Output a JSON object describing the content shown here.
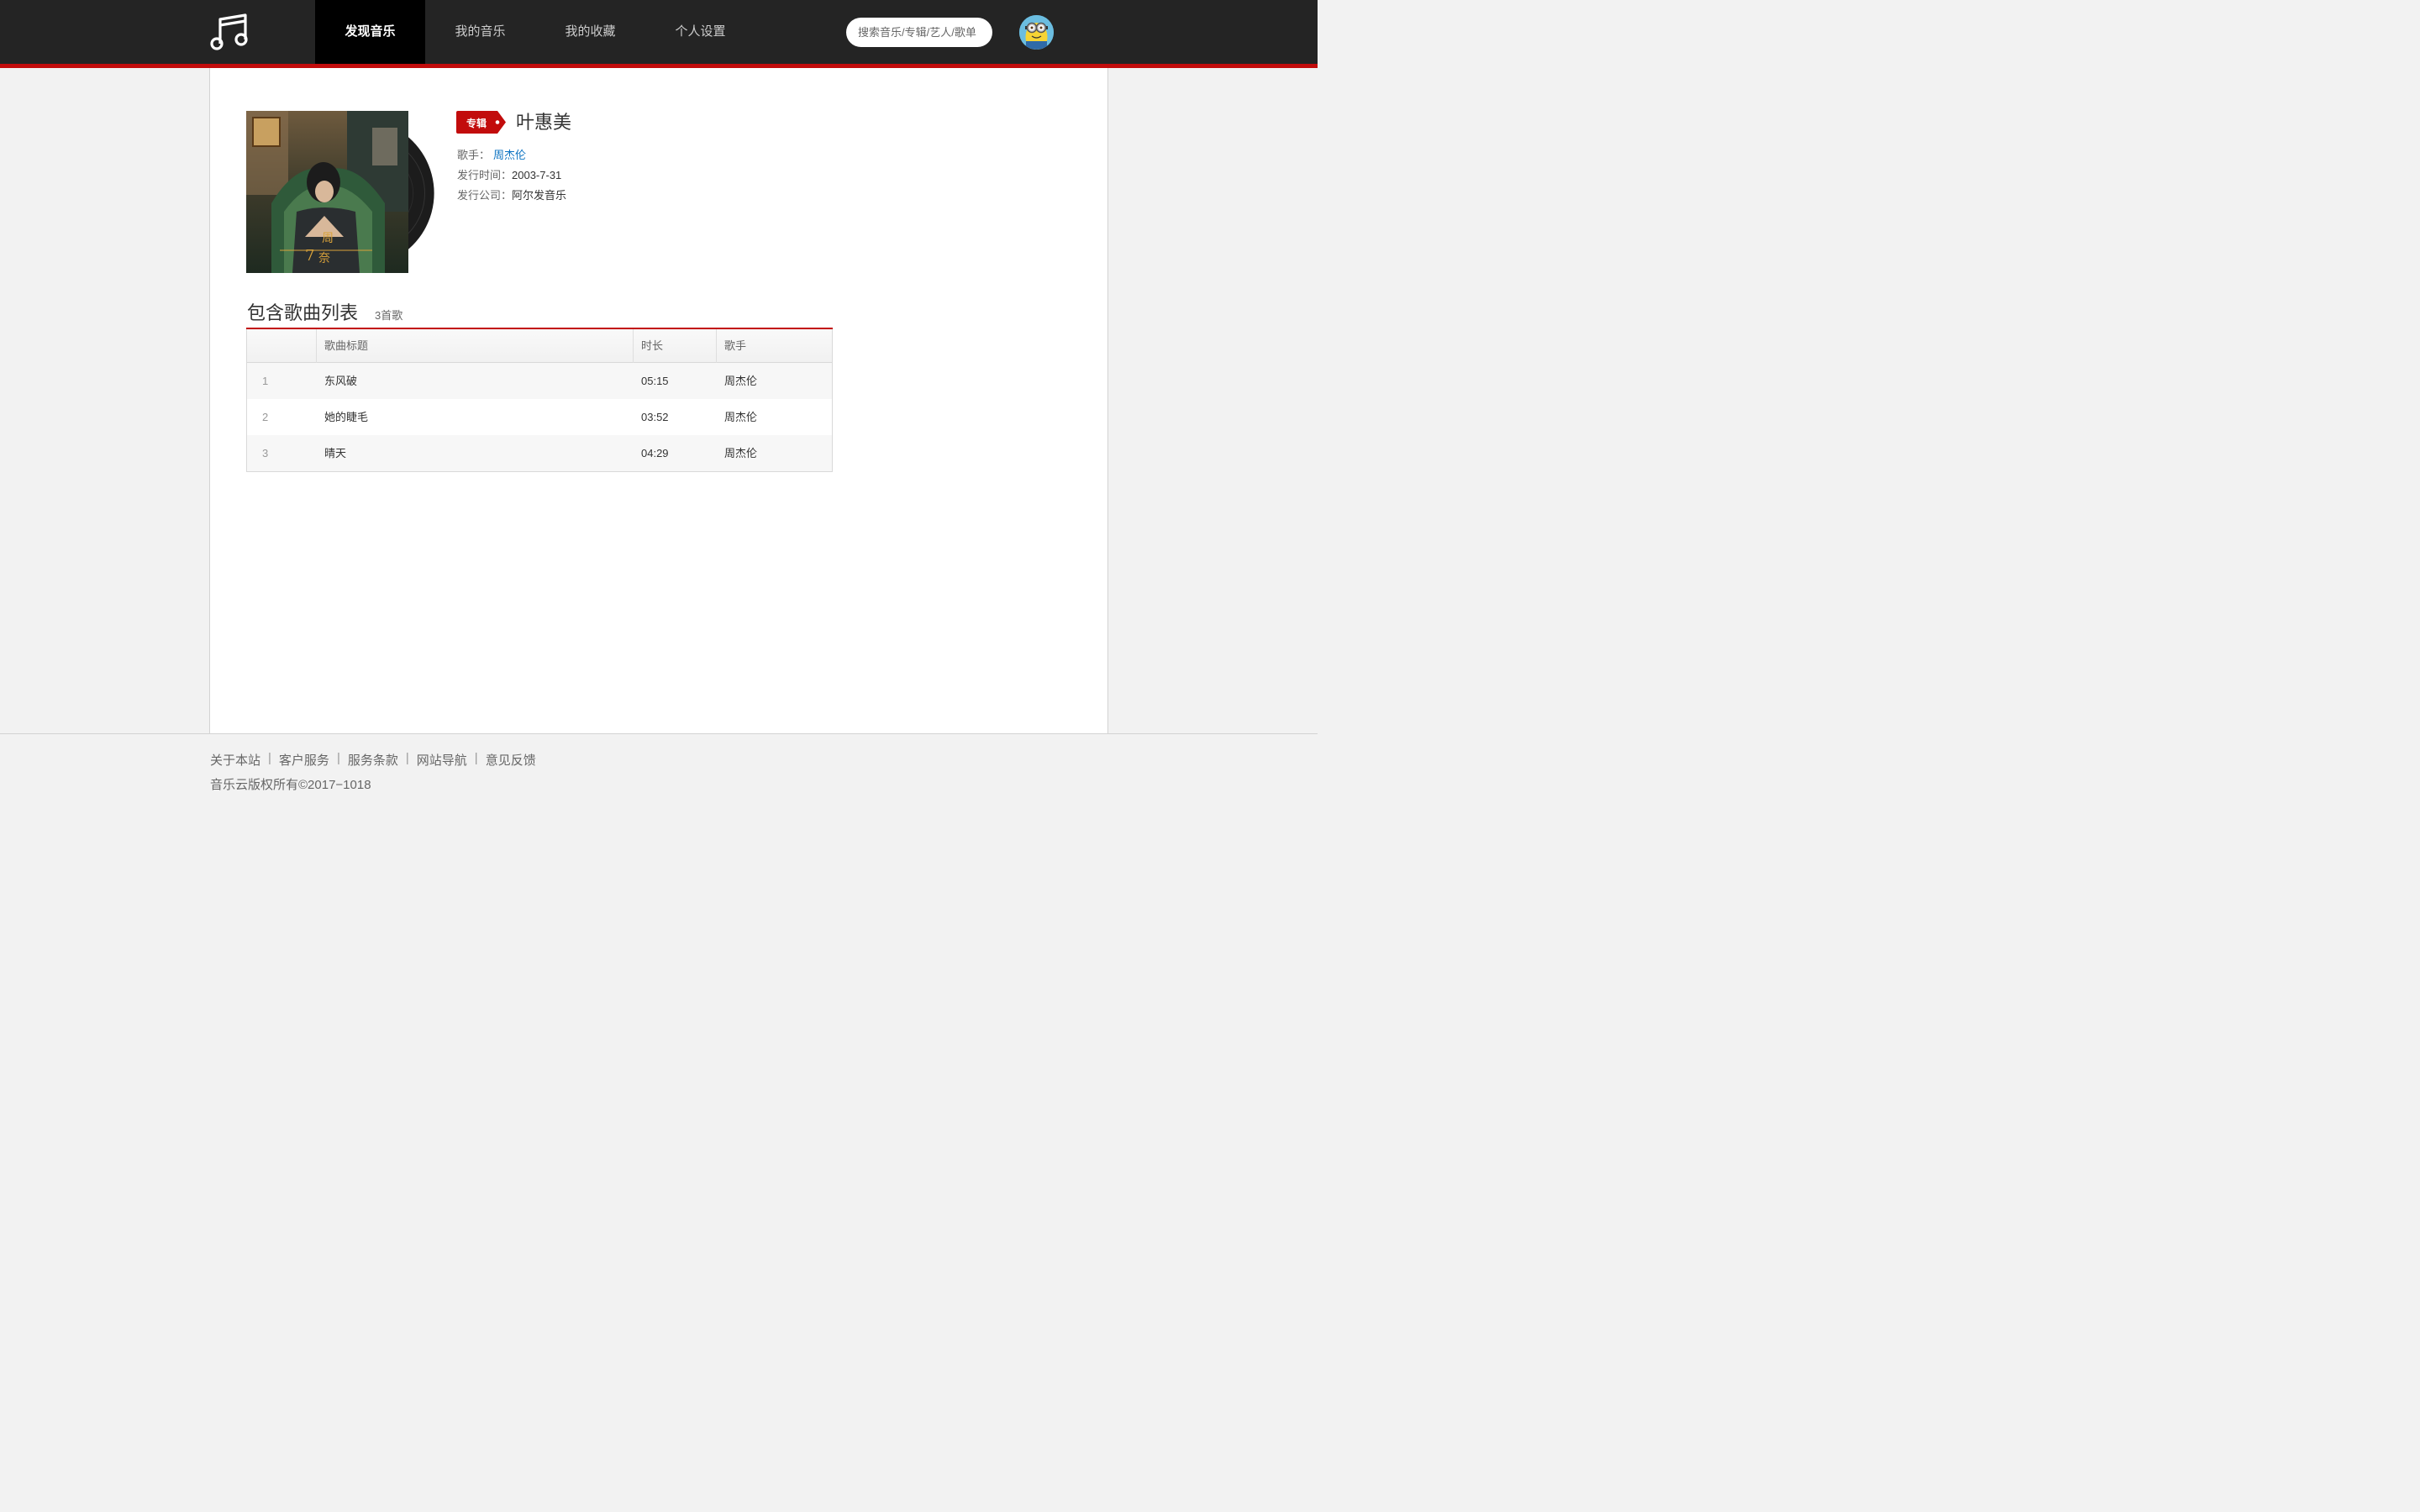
{
  "nav": {
    "items": [
      {
        "label": "发现音乐",
        "active": true
      },
      {
        "label": "我的音乐",
        "active": false
      },
      {
        "label": "我的收藏",
        "active": false
      },
      {
        "label": "个人设置",
        "active": false
      }
    ],
    "search_placeholder": "搜索音乐/专辑/艺人/歌单",
    "logo_icon": "music-note-icon",
    "avatar_icon": "minion-avatar"
  },
  "album": {
    "tag_label": "专辑",
    "title": "叶惠美",
    "artist_label": "歌手：",
    "artist": "周杰伦",
    "release_label": "发行时间：",
    "release_date": "2003-7-31",
    "company_label": "发行公司：",
    "company": "阿尔发音乐"
  },
  "song_list": {
    "title": "包含歌曲列表",
    "count": "3首歌",
    "headers": [
      "",
      "歌曲标题",
      "时长",
      "歌手"
    ],
    "rows": [
      {
        "index": "1",
        "title": "东风破",
        "duration": "05:15",
        "artist": "周杰伦"
      },
      {
        "index": "2",
        "title": "她的睫毛",
        "duration": "03:52",
        "artist": "周杰伦"
      },
      {
        "index": "3",
        "title": "晴天",
        "duration": "04:29",
        "artist": "周杰伦"
      }
    ]
  },
  "footer": {
    "links": [
      "关于本站",
      "客户服务",
      "服务条款",
      "网站导航",
      "意见反馈"
    ],
    "separator": "|",
    "copyright": "音乐云版权所有©2017−1018"
  },
  "colors": {
    "topbar": "#242424",
    "accent_red": "#c20c0c",
    "link_blue": "#0c73c2"
  }
}
